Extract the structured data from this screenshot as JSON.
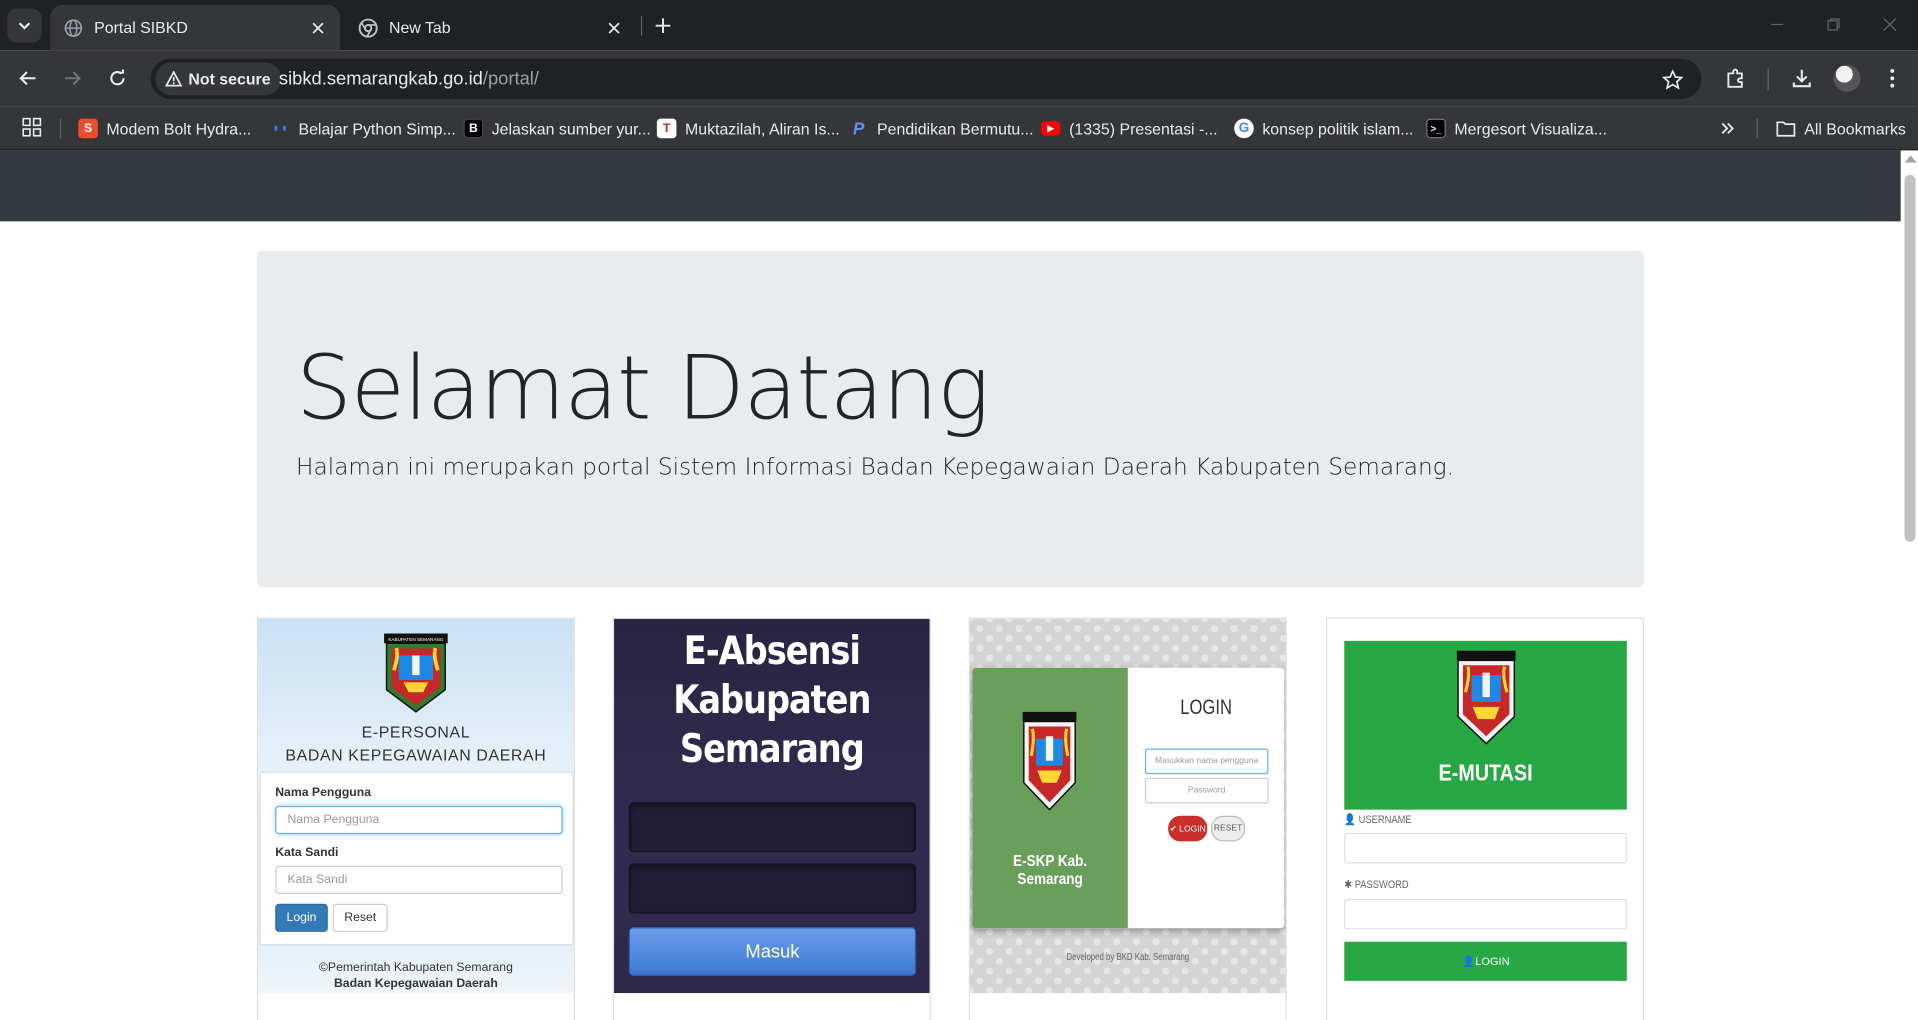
{
  "browser": {
    "tabs": [
      {
        "title": "Portal SIBKD",
        "active": true
      },
      {
        "title": "New Tab",
        "active": false
      }
    ],
    "security_chip": "Not secure",
    "url_host": "sibkd.semarangkab.go.id",
    "url_path": "/portal/",
    "bookmarks": [
      {
        "label": "Modem Bolt Hydra...",
        "icon": "shopee-icon",
        "color": "#ee4d2d"
      },
      {
        "label": "Belajar Python Simp...",
        "icon": "dicoding-icon",
        "color": "#2d7ff9"
      },
      {
        "label": "Jelaskan sumber yur...",
        "icon": "brainly-icon",
        "color": "#000000"
      },
      {
        "label": "Muktazilah, Aliran Is...",
        "icon": "t-icon",
        "color": "#ffffff"
      },
      {
        "label": "Pendidikan Bermutu...",
        "icon": "paypal-like-icon",
        "color": "#253b80"
      },
      {
        "label": "(1335) Presentasi -...",
        "icon": "youtube-icon",
        "color": "#ff0000"
      },
      {
        "label": "konsep politik islam...",
        "icon": "google-icon",
        "color": "#ffffff"
      },
      {
        "label": "Mergesort Visualiza...",
        "icon": "terminal-icon",
        "color": "#000000"
      }
    ],
    "all_bookmarks": "All Bookmarks"
  },
  "jumbotron": {
    "title": "Selamat Datang",
    "lead": "Halaman ini merupakan portal Sistem Informasi Badan Kepegawaian Daerah Kabupaten Semarang."
  },
  "cards": {
    "epersonal": {
      "logo_caption": "KABUPATEN SEMARANG",
      "title1": "E-PERSONAL",
      "title2": "BADAN KEPEGAWAIAN DAERAH",
      "username_label": "Nama Pengguna",
      "username_placeholder": "Nama Pengguna",
      "password_label": "Kata Sandi",
      "password_placeholder": "Kata Sandi",
      "login": "Login",
      "reset": "Reset",
      "footer1": "©Pemerintah Kabupaten Semarang",
      "footer2": "Badan Kepegawaian Daerah"
    },
    "eabsensi": {
      "title_line1": "E-Absensi",
      "title_line2": "Kabupaten",
      "title_line3": "Semarang",
      "button": "Masuk"
    },
    "eskp": {
      "brand": "E-SKP Kab. Semarang",
      "heading": "LOGIN",
      "username_placeholder": "Masukkan nama pengguna",
      "password_placeholder": "Password",
      "login": "✔ LOGIN",
      "reset": "RESET",
      "developer": "Developed by BKD Kab. Semarang"
    },
    "emutasi": {
      "title": "E-MUTASI",
      "username_label": "USERNAME",
      "password_label": "PASSWORD",
      "button": "LOGIN"
    }
  }
}
